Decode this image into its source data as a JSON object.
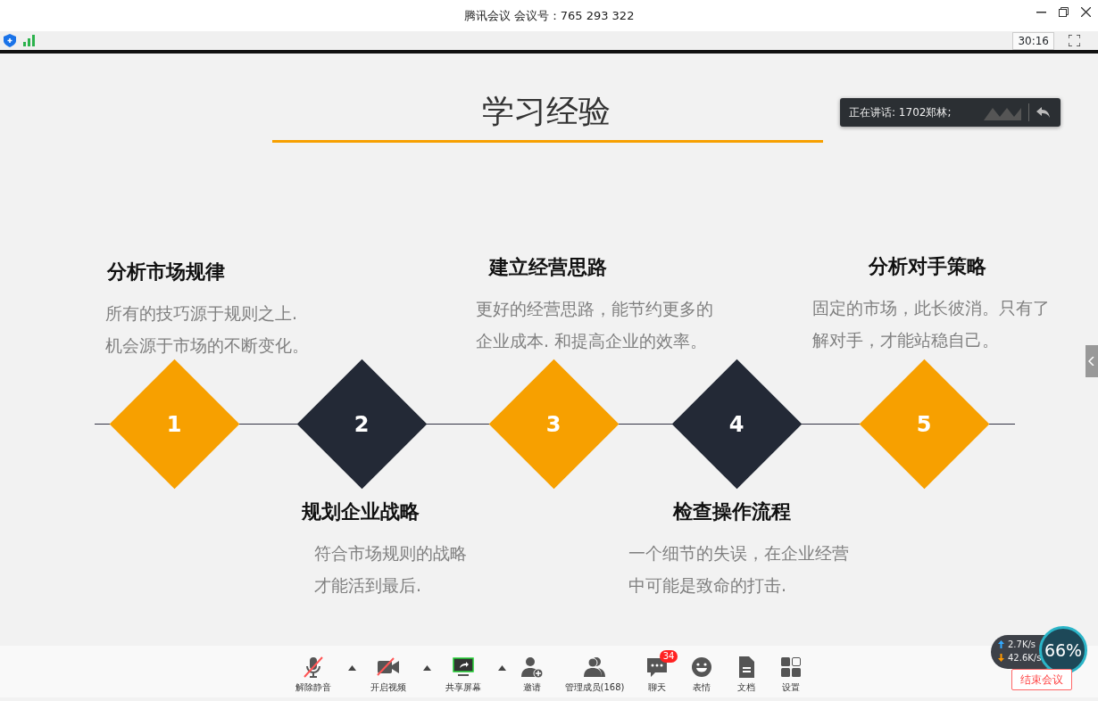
{
  "window": {
    "title": "腾讯会议 会议号：765 293 322"
  },
  "status_bar": {
    "timer": "30:16"
  },
  "speaker": {
    "label": "正在讲话: 1702郑林;"
  },
  "slide": {
    "title": "学习经验",
    "steps": [
      {
        "number": "1",
        "kind": "above",
        "color": "#f7a000",
        "title": "分析市场规律",
        "lines": [
          "所有的技巧源于规则之上.",
          "机会源于市场的不断变化。"
        ]
      },
      {
        "number": "2",
        "kind": "below",
        "color": "#232936",
        "title": "规划企业战略",
        "lines": [
          "符合市场规则的战略",
          "才能活到最后."
        ]
      },
      {
        "number": "3",
        "kind": "above",
        "color": "#f7a000",
        "title": "建立经营思路",
        "lines": [
          "更好的经营思路，能节约更多的",
          "企业成本. 和提高企业的效率。"
        ]
      },
      {
        "number": "4",
        "kind": "below",
        "color": "#232936",
        "title": "检查操作流程",
        "lines": [
          "一个细节的失误，在企业经营",
          "中可能是致命的打击."
        ]
      },
      {
        "number": "5",
        "kind": "above",
        "color": "#f7a000",
        "title": "分析对手策略",
        "lines": [
          "固定的市场，此长彼消。只有了",
          "解对手，才能站稳自己。"
        ]
      }
    ]
  },
  "toolbar": [
    {
      "kind": "mic",
      "label": "解除静音",
      "caret": true
    },
    {
      "kind": "video",
      "label": "开启视频",
      "caret": true
    },
    {
      "kind": "share",
      "label": "共享屏幕",
      "caret": true
    },
    {
      "kind": "invite",
      "label": "邀请",
      "caret": false
    },
    {
      "kind": "members",
      "label": "管理成员(168)",
      "caret": false
    },
    {
      "kind": "chat",
      "label": "聊天",
      "caret": false,
      "badge": "34"
    },
    {
      "kind": "emoji",
      "label": "表情",
      "caret": false
    },
    {
      "kind": "doc",
      "label": "文档",
      "caret": false
    },
    {
      "kind": "settings",
      "label": "设置",
      "caret": false
    }
  ],
  "network": {
    "upload": "2.7K/s",
    "download": "42.6K/s",
    "quality": "66%"
  },
  "end_button": {
    "label": "结束会议"
  }
}
